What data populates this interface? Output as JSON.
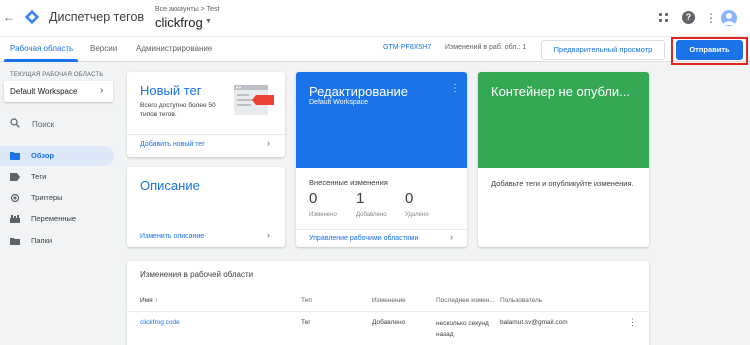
{
  "header": {
    "back_glyph": "←",
    "app_title": "Диспетчер тегов",
    "breadcrumb": "Все аккаунты > Test",
    "container_name": "clickfrog",
    "help_glyph": "?",
    "more_glyph": "⋮"
  },
  "tabs": {
    "workspace": "Рабочая область",
    "versions": "Версии",
    "admin": "Администрирование"
  },
  "toolbar": {
    "container_id": "GTM-PF8X5H7",
    "changes_count": "Изменений в раб. обл.: 1",
    "preview_label": "Предварительный просмотр",
    "submit_label": "Отправить"
  },
  "sidebar": {
    "workspace_label": "ТЕКУЩАЯ РАБОЧАЯ ОБЛАСТЬ",
    "workspace_name": "Default Workspace",
    "search_placeholder": "Поиск",
    "items": [
      {
        "label": "Обзор",
        "icon": "overview-icon",
        "active": true
      },
      {
        "label": "Теги",
        "icon": "tag-icon"
      },
      {
        "label": "Триггеры",
        "icon": "trigger-icon"
      },
      {
        "label": "Переменные",
        "icon": "variables-icon"
      },
      {
        "label": "Папки",
        "icon": "folder-icon"
      }
    ]
  },
  "cards": {
    "new_tag": {
      "title": "Новый тег",
      "description": "Всего доступно более 50 типов тегов.",
      "link": "Добавить новый тег"
    },
    "description": {
      "title": "Описание",
      "link": "Изменить описание"
    },
    "editing": {
      "title": "Редактирование",
      "subtitle": "Default Workspace",
      "changes_title": "Внесенные изменения",
      "stats": [
        {
          "value": "0",
          "label": "Изменено"
        },
        {
          "value": "1",
          "label": "Добавлено"
        },
        {
          "value": "0",
          "label": "Удалено"
        }
      ],
      "link": "Управление рабочими областями",
      "color": "#1a73e8"
    },
    "publish": {
      "title": "Контейнер не опубли...",
      "text": "Добавьте теги и опубликуйте изменения.",
      "color": "#34a853"
    }
  },
  "workspace_changes": {
    "title": "Изменения в рабочей области",
    "columns": [
      "Имя ↑",
      "Тип",
      "Изменение",
      "Последнее измен...",
      "Пользователь"
    ],
    "rows": [
      {
        "name": "clickfrog code",
        "type": "Тег",
        "change": "Добавлено",
        "last_modified": "несколько секунд назад",
        "user": "balamut.sv@gmail.com"
      }
    ]
  }
}
